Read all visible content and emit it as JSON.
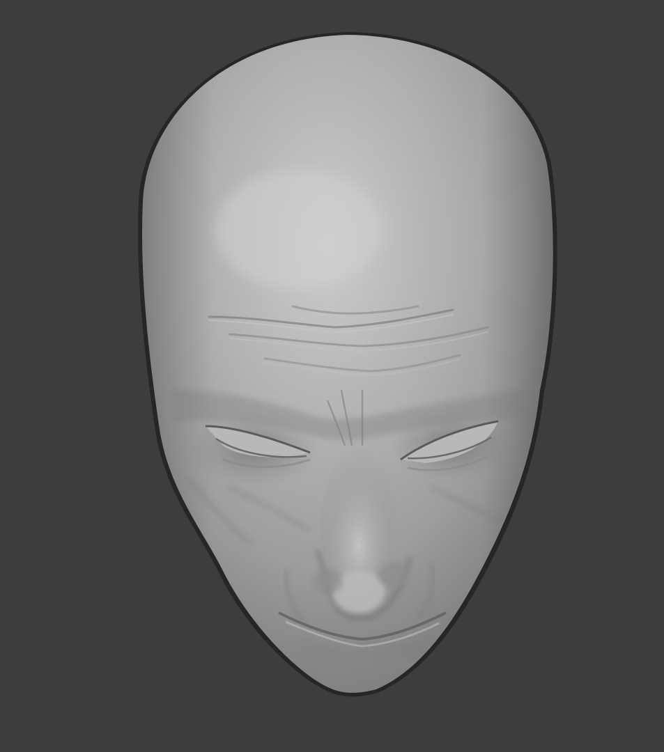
{
  "viewport": {
    "background_color": "#3d3d3d",
    "mesh_color": "#a9a9a9",
    "mesh_highlight_color": "#cbcbcb",
    "mesh_shadow_color": "#5e5e5e",
    "outline_color": "#252525"
  },
  "object": {
    "type": "sculpted-head-mesh",
    "view": "front"
  }
}
